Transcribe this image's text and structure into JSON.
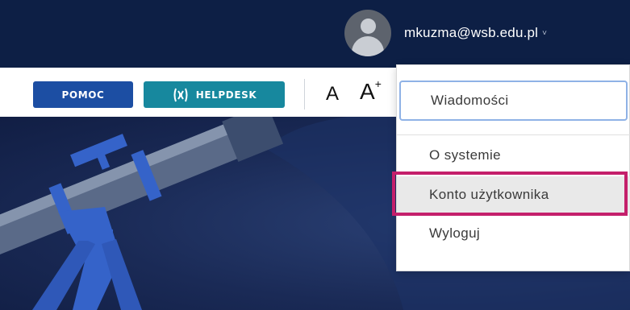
{
  "header": {
    "user_email": "mkuzma@wsb.edu.pl",
    "user_caret": "˅",
    "avatar_icon": "user-avatar-icon"
  },
  "toolbar": {
    "pomoc_label": "POMOC",
    "helpdesk_label": "HELPDESK",
    "helpdesk_icon": "helpdesk-logo-icon",
    "font_small_label": "A",
    "font_large_label": "A",
    "font_large_sup": "+"
  },
  "user_menu": {
    "items": [
      {
        "label": "Wiadomości"
      },
      {
        "label": "O systemie"
      },
      {
        "label": "Konto użytkownika"
      },
      {
        "label": "Wyloguj"
      }
    ]
  },
  "colors": {
    "topbar": "#0d1f45",
    "pomoc_button": "#1c4ea3",
    "helpdesk_button": "#17889e",
    "highlight": "#c41f6b",
    "focus_ring": "#8fb2e6",
    "hover_row": "#e9e9e9"
  }
}
